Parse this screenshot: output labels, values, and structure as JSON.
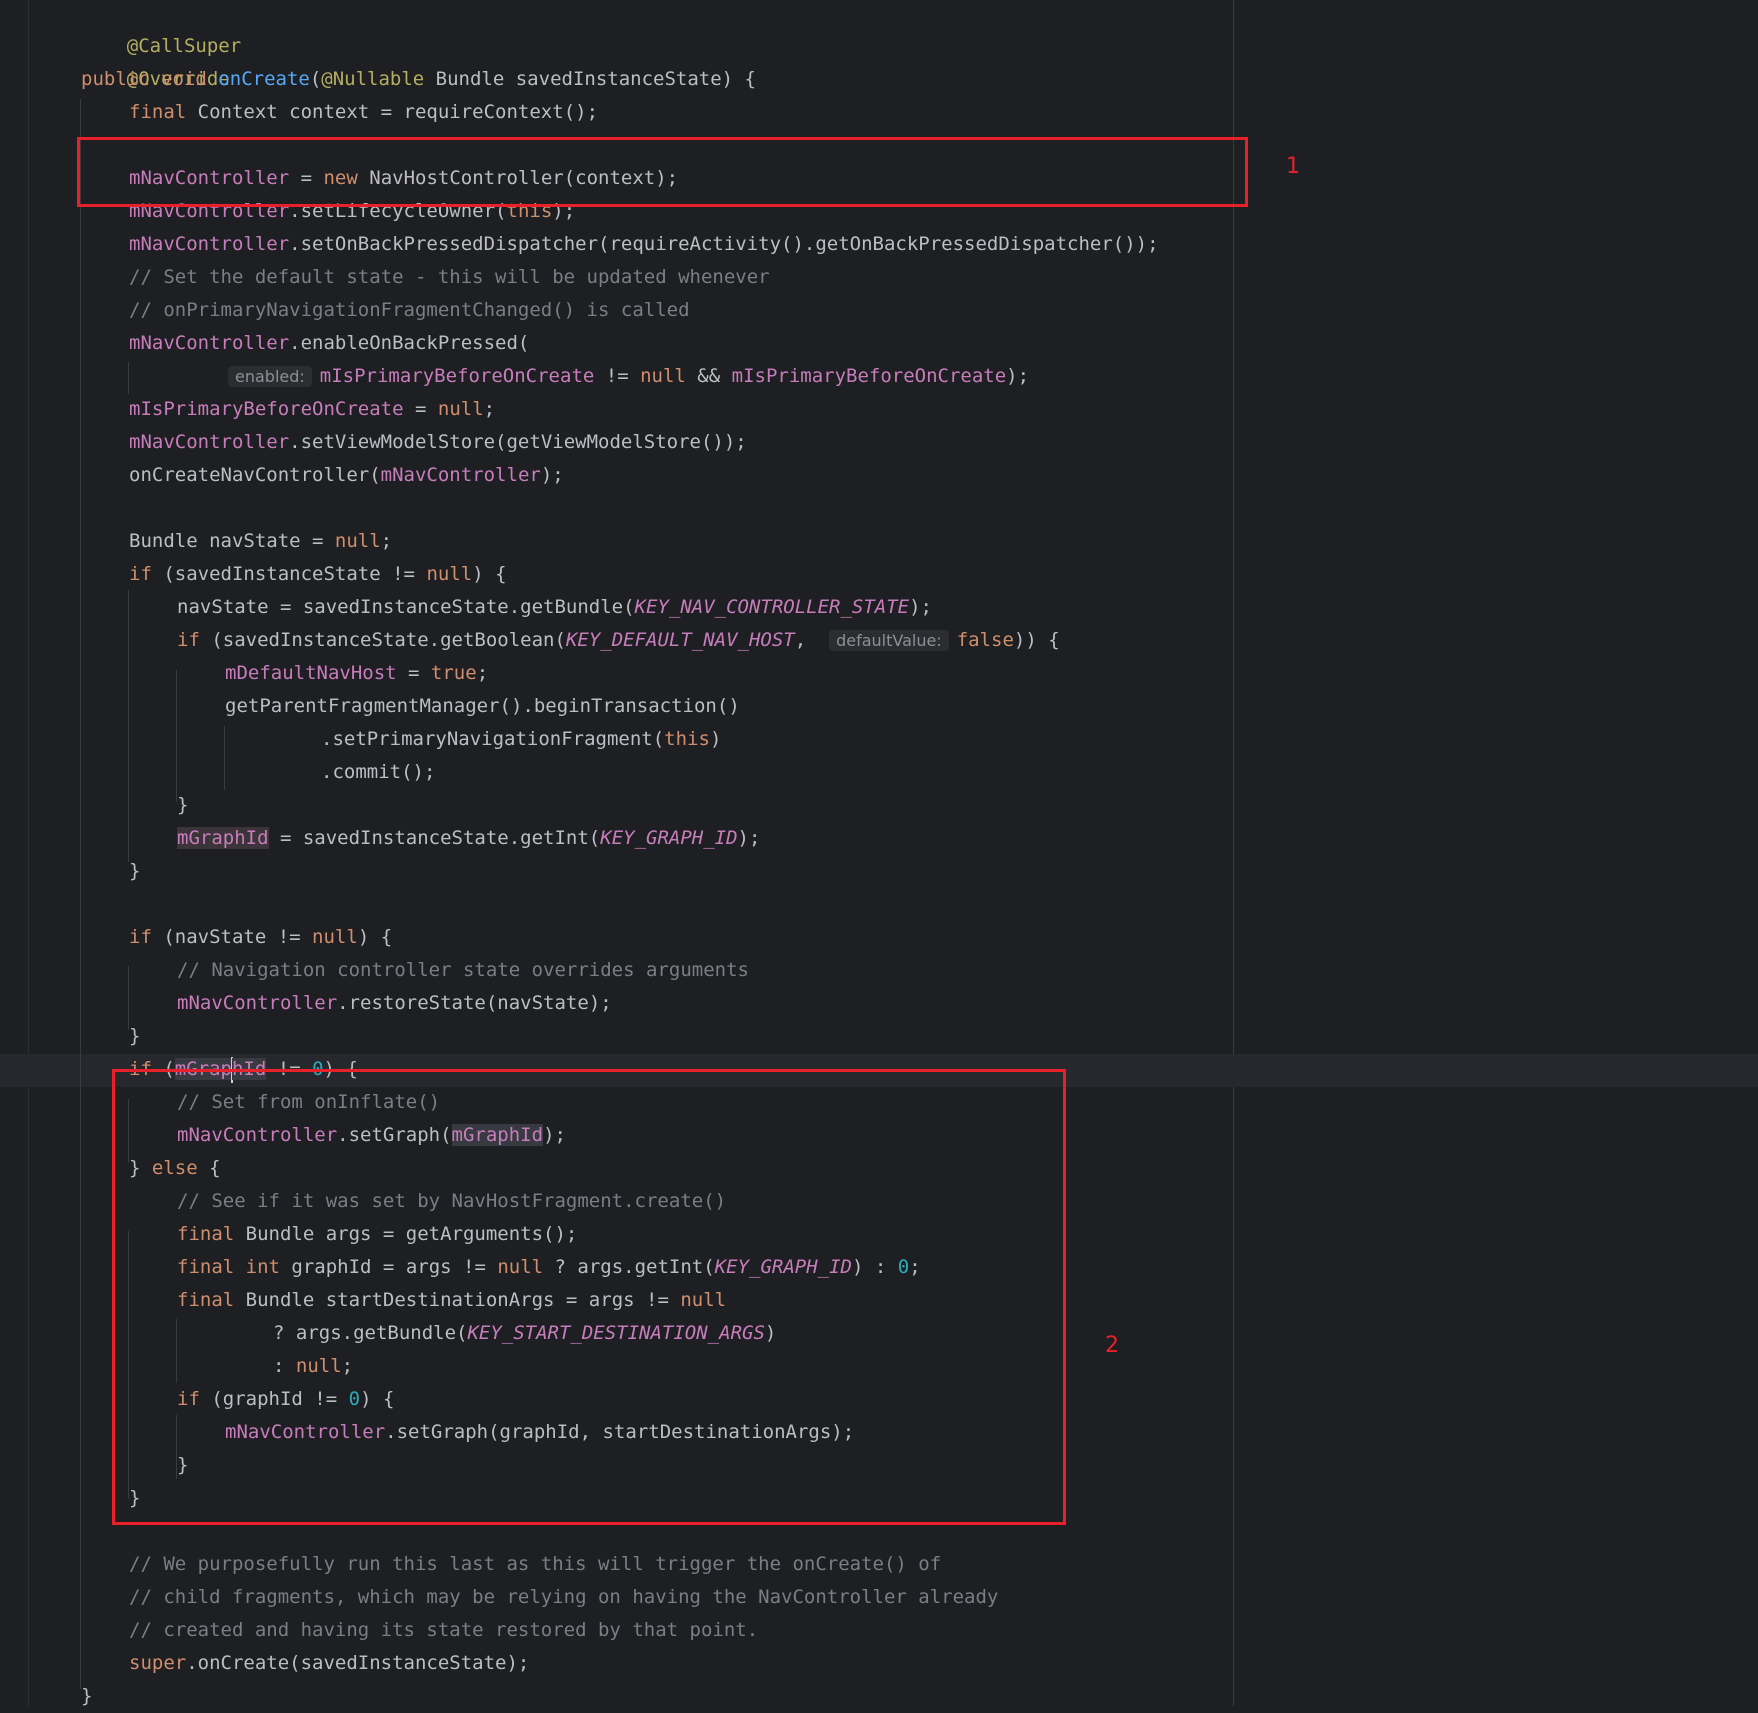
{
  "annotations": {
    "call_super": "@CallSuper",
    "override": "@Override",
    "nullable": "@Nullable"
  },
  "code": {
    "kw_public": "public",
    "kw_void": "void",
    "kw_final": "final",
    "kw_new": "new",
    "kw_null": "null",
    "kw_if": "if",
    "kw_else": "else",
    "kw_true": "true",
    "kw_false": "false",
    "kw_this": "this",
    "kw_int": "int",
    "kw_super": "super",
    "method_oncreate": "onCreate",
    "field_nav": "mNavController",
    "field_primary": "mIsPrimaryBeforeOnCreate",
    "field_default": "mDefaultNavHost",
    "field_graph": "mGraphId",
    "const_nav_state": "KEY_NAV_CONTROLLER_STATE",
    "const_default_host": "KEY_DEFAULT_NAV_HOST",
    "const_graph_id": "KEY_GRAPH_ID",
    "const_start_args": "KEY_START_DESTINATION_ARGS",
    "zero": "0",
    "hint_enabled": "enabled:",
    "hint_default_value": "defaultValue:",
    "sig_open": "(",
    "sig_tail": " Bundle savedInstanceState) {",
    "l4": " Context context = requireContext();",
    "l6_eq": " = ",
    "l6_tail": " NavHostController(context);",
    "l7_tail": ".setLifecycleOwner(",
    "l7_end": ");",
    "l8_tail": ".setOnBackPressedDispatcher(requireActivity().getOnBackPressedDispatcher());",
    "c9": "// Set the default state - this will be updated whenever",
    "c10": "// onPrimaryNavigationFragmentChanged() is called",
    "l11_tail": ".enableOnBackPressed(",
    "l12_mid": " != ",
    "l12_and": " && ",
    "l12_end": ");",
    "l13_eq": " = ",
    "semi": ";",
    "l14_tail": ".setViewModelStore(getViewModelStore());",
    "l15_head": "onCreateNavController(",
    "l15_end": ");",
    "l17_head": "Bundle navState = ",
    "l18_head": " (savedInstanceState != ",
    "l18_end": ") {",
    "l19_head": "navState = savedInstanceState.getBundle(",
    "l19_end": ");",
    "l20_head": " (savedInstanceState.getBoolean(",
    "l20_comma": ", ",
    "l20_end": ")) {",
    "l21_eq": " = ",
    "l22": "getParentFragmentManager().beginTransaction()",
    "l23_head": ".setPrimaryNavigationFragment(",
    "l23_end": ")",
    "l24": ".commit();",
    "close_brace": "}",
    "l26_mid": " = savedInstanceState.getInt(",
    "l26_end": ");",
    "l29_head": " (navState != ",
    "l29_end": ") {",
    "c30": "// Navigation controller state overrides arguments",
    "l31_tail": ".restoreState(navState);",
    "l33_head": " (",
    "l33_g1": "mGrap",
    "l33_g2": "hId",
    "l33_mid": " != ",
    "l33_end": ") {",
    "c34": "// Set from onInflate()",
    "l35_mid": ".setGraph(",
    "l35_end": ");",
    "l36_head": "} ",
    "l36_end": " {",
    "c37": "// See if it was set by NavHostFragment.create()",
    "l38": " Bundle args = getArguments();",
    "l39_a": " graphId = args != ",
    "l39_b": " ? args.getInt(",
    "l39_c": ") : ",
    "l40": " Bundle startDestinationArgs = args != ",
    "l41_head": "? args.getBundle(",
    "l41_end": ")",
    "l42_head": ": ",
    "l43_head": " (graphId != ",
    "l43_end": ") {",
    "l44_tail": ".setGraph(graphId, startDestinationArgs);",
    "c48": "// We purposefully run this last as this will trigger the onCreate() of",
    "c49": "// child fragments, which may be relying on having the NavController already",
    "c50": "// created and having its state restored by that point.",
    "l51_tail": ".onCreate(savedInstanceState);"
  },
  "labels": {
    "box1": "1",
    "box2": "2"
  },
  "colors": {
    "background": "#1e1f22",
    "keyword": "#cf8e6d",
    "annotation": "#b3ae60",
    "field": "#c77dbb",
    "method": "#56a8f5",
    "number": "#2aacb8",
    "comment": "#7a7e85",
    "highlight_box": "#e8202a"
  }
}
